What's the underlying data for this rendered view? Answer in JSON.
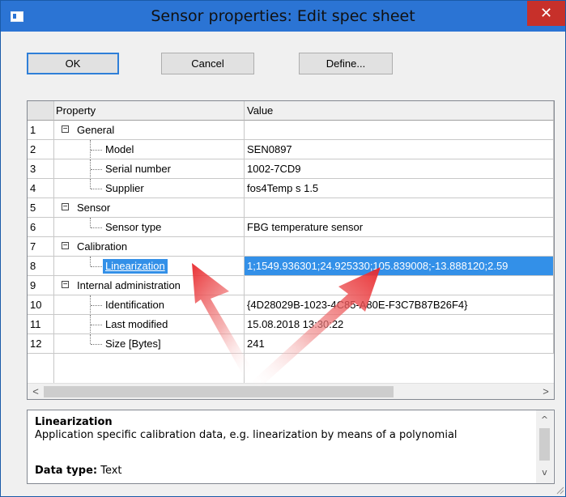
{
  "window": {
    "title": "Sensor properties: Edit spec sheet",
    "close_glyph": "✕"
  },
  "buttons": {
    "ok": "OK",
    "cancel": "Cancel",
    "define": "Define..."
  },
  "grid": {
    "headers": {
      "property": "Property",
      "value": "Value"
    },
    "rows": [
      {
        "num": "1",
        "label": "General",
        "value": ""
      },
      {
        "num": "2",
        "label": "Model",
        "value": "SEN0897"
      },
      {
        "num": "3",
        "label": "Serial number",
        "value": "1002-7CD9"
      },
      {
        "num": "4",
        "label": "Supplier",
        "value": "fos4Temp s 1.5"
      },
      {
        "num": "5",
        "label": "Sensor",
        "value": ""
      },
      {
        "num": "6",
        "label": "Sensor type",
        "value": "FBG temperature sensor"
      },
      {
        "num": "7",
        "label": "Calibration",
        "value": ""
      },
      {
        "num": "8",
        "label": "Linearization",
        "value": "1;1549.936301;24.925330;105.839008;-13.888120;2.59"
      },
      {
        "num": "9",
        "label": "Internal administration",
        "value": ""
      },
      {
        "num": "10",
        "label": "Identification",
        "value": "{4D28029B-1023-4C85-A80E-F3C7B87B26F4}"
      },
      {
        "num": "11",
        "label": "Last modified",
        "value": "15.08.2018  13:30:22"
      },
      {
        "num": "12",
        "label": "Size [Bytes]",
        "value": "241"
      }
    ],
    "collapse_glyph": "−"
  },
  "description": {
    "title": "Linearization",
    "text": "Application specific calibration data, e.g. linearization by means of a polynomial",
    "data_type_label": "Data type:",
    "data_type_value": "Text"
  },
  "scroll": {
    "left": "<",
    "right": ">",
    "up": "^",
    "down": "v"
  },
  "colors": {
    "selection": "#3390e8",
    "titlebar": "#2b74d4",
    "close": "#c7302a",
    "arrow": "#e8262a"
  },
  "icons": {
    "app": "app-window-icon",
    "close": "close-icon",
    "resize": "resize-grip-icon"
  }
}
